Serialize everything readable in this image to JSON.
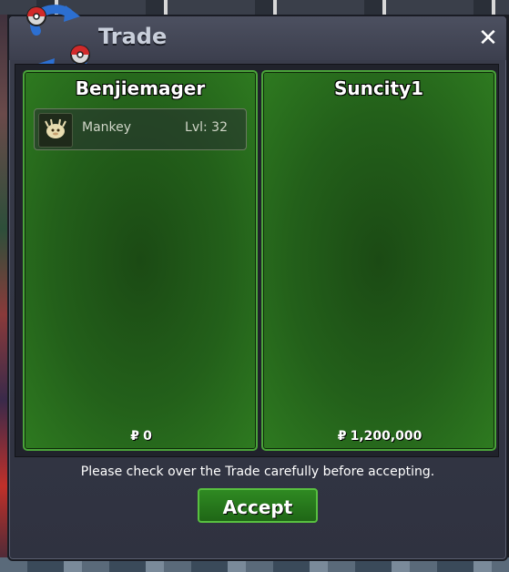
{
  "window": {
    "title": "Trade",
    "close_label": "✕",
    "logo_icon": "pokeball-swap-icon"
  },
  "left_panel": {
    "player_name": "Benjiemager",
    "items": [
      {
        "name": "Mankey",
        "level": "Lvl: 32",
        "icon": "mankey-sprite-icon"
      }
    ],
    "money": "0"
  },
  "right_panel": {
    "player_name": "Suncity1",
    "items": [],
    "money": "1,200,000"
  },
  "currency_symbol": "₽",
  "notice": "Please check over the Trade carefully before accepting.",
  "accept_label": "Accept",
  "colors": {
    "panel_border": "#4aa33a",
    "accept_bg": "#2f8a22"
  }
}
